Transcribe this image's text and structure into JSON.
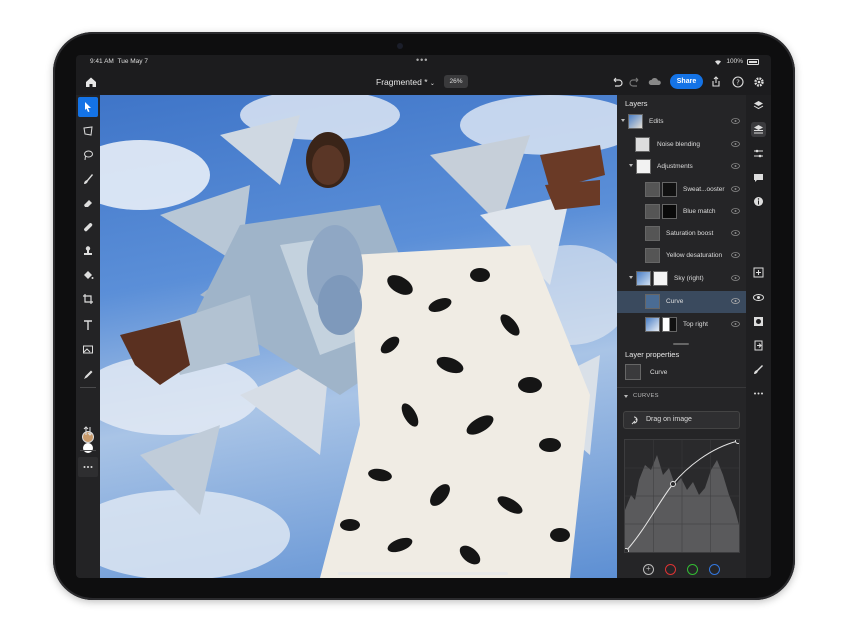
{
  "status": {
    "time": "9:41 AM",
    "date": "Tue May 7",
    "battery": "100%"
  },
  "toolbar": {
    "doc_title": "Fragmented *",
    "zoom": "26%",
    "share_label": "Share"
  },
  "layers": {
    "title": "Layers",
    "rows": [
      {
        "label": "Edits"
      },
      {
        "label": "Noise blending"
      },
      {
        "label": "Adjustments"
      },
      {
        "label": "Sweat...ooster"
      },
      {
        "label": "Blue match"
      },
      {
        "label": "Saturation boost"
      },
      {
        "label": "Yellow desaturation"
      },
      {
        "label": "Sky (right)"
      },
      {
        "label": "Curve",
        "selected": true
      },
      {
        "label": "Top right"
      }
    ]
  },
  "properties": {
    "title": "Layer properties",
    "layer_name": "Curve",
    "section": "CURVES",
    "drag_label": "Drag on image"
  },
  "colors": {
    "accent": "#1473e6",
    "fg_swatch": "#c89a6b",
    "bg_swatch": "#ffffff"
  }
}
